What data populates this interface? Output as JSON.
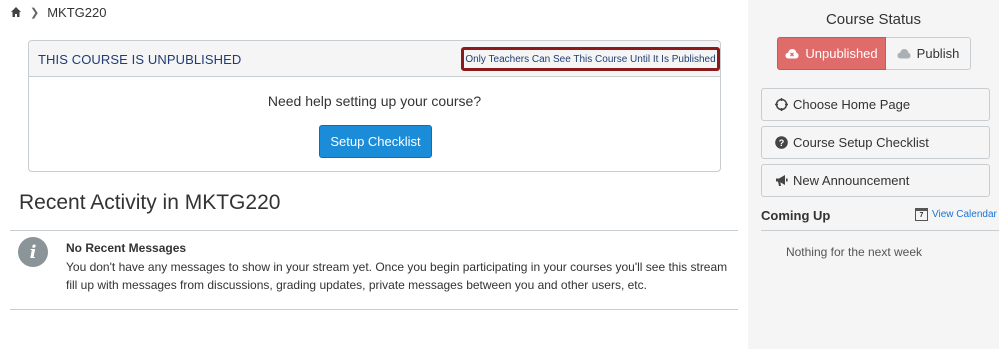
{
  "breadcrumb": {
    "course": "MKTG220"
  },
  "notice": {
    "title": "THIS COURSE IS UNPUBLISHED",
    "flag": "Only Teachers Can See This Course Until It Is Published",
    "help": "Need help setting up your course?",
    "button": "Setup Checklist"
  },
  "stream": {
    "title": "Recent Activity in MKTG220",
    "heading": "No Recent Messages",
    "body": "You don't have any messages to show in your stream yet. Once you begin participating in your courses you'll see this stream fill up with messages from discussions, grading updates, private messages between you and other users, etc."
  },
  "sidebar": {
    "status_title": "Course Status",
    "unpublished": "Unpublished",
    "publish": "Publish",
    "buttons": [
      {
        "label": "Choose Home Page",
        "icon": "crosshair-icon"
      },
      {
        "label": "Course Setup Checklist",
        "icon": "question-circle-icon"
      },
      {
        "label": "New Announcement",
        "icon": "megaphone-icon"
      }
    ],
    "coming_up": "Coming Up",
    "view_calendar": "View Calendar",
    "calendar_day": "7",
    "nothing": "Nothing for the next week"
  },
  "colors": {
    "unpublished_bg": "#e06b6b",
    "primary_button": "#1a8cd8",
    "flag_border": "#8b1a1a",
    "link": "#1a73d4"
  }
}
